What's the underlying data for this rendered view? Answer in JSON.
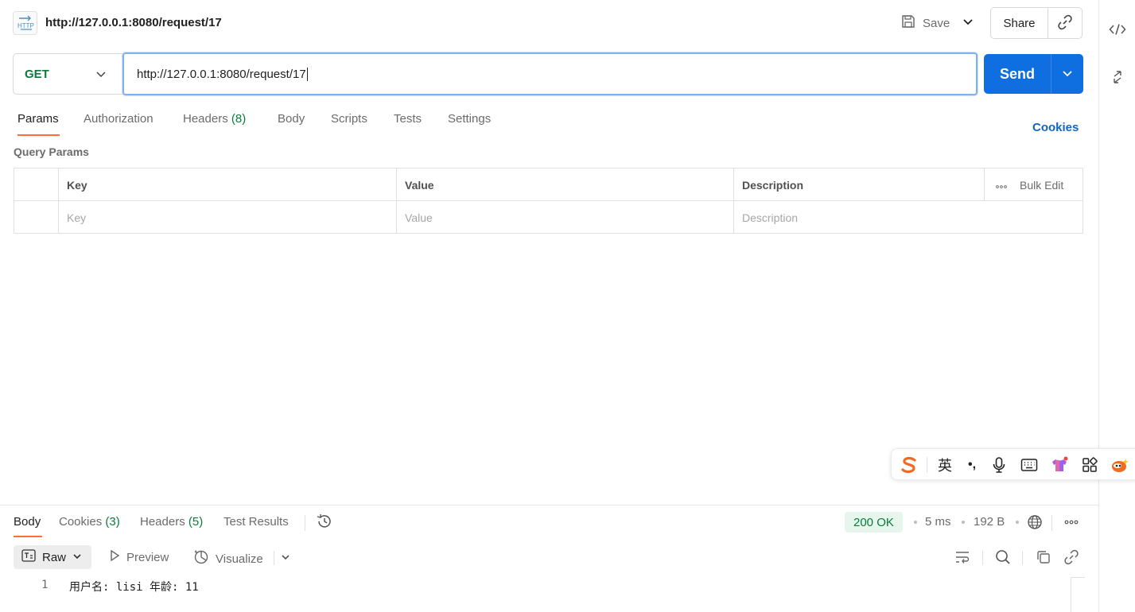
{
  "header": {
    "request_title": "http://127.0.0.1:8080/request/17",
    "http_badge": "HTTP",
    "save_label": "Save",
    "share_label": "Share"
  },
  "request": {
    "method": "GET",
    "url": "http://127.0.0.1:8080/request/17",
    "send_label": "Send"
  },
  "tabs": {
    "params": "Params",
    "authorization": "Authorization",
    "headers": "Headers",
    "headers_count": "(8)",
    "body": "Body",
    "scripts": "Scripts",
    "tests": "Tests",
    "settings": "Settings",
    "cookies": "Cookies",
    "active": "Params"
  },
  "params": {
    "section_title": "Query Params",
    "columns": {
      "key": "Key",
      "value": "Value",
      "description": "Description"
    },
    "bulk_edit": "Bulk Edit",
    "placeholders": {
      "key": "Key",
      "value": "Value",
      "description": "Description"
    }
  },
  "ime": {
    "lang": "英",
    "punct": "•,"
  },
  "response": {
    "tabs": {
      "body": "Body",
      "cookies": "Cookies",
      "cookies_count": "(3)",
      "headers": "Headers",
      "headers_count": "(5)",
      "test_results": "Test Results"
    },
    "status": "200 OK",
    "time": "5 ms",
    "size": "192 B",
    "format": "Raw",
    "preview": "Preview",
    "visualize": "Visualize",
    "lines": [
      {
        "no": "1",
        "text": "用户名: lisi 年龄: 11"
      }
    ]
  },
  "colors": {
    "accent": "#ff6c37",
    "send": "#0f6fe0",
    "method_get": "#0b7a3b",
    "status_ok_bg": "#e7f6ec",
    "link": "#1565c0"
  },
  "icons": {
    "code": "code-icon",
    "collapse": "collapse-icon",
    "save": "save-icon",
    "link": "link-icon",
    "history": "history-icon",
    "globe": "globe-icon",
    "more": "more-icon",
    "wrap": "wrap-lines-icon",
    "search": "search-icon",
    "copy": "copy-icon"
  }
}
